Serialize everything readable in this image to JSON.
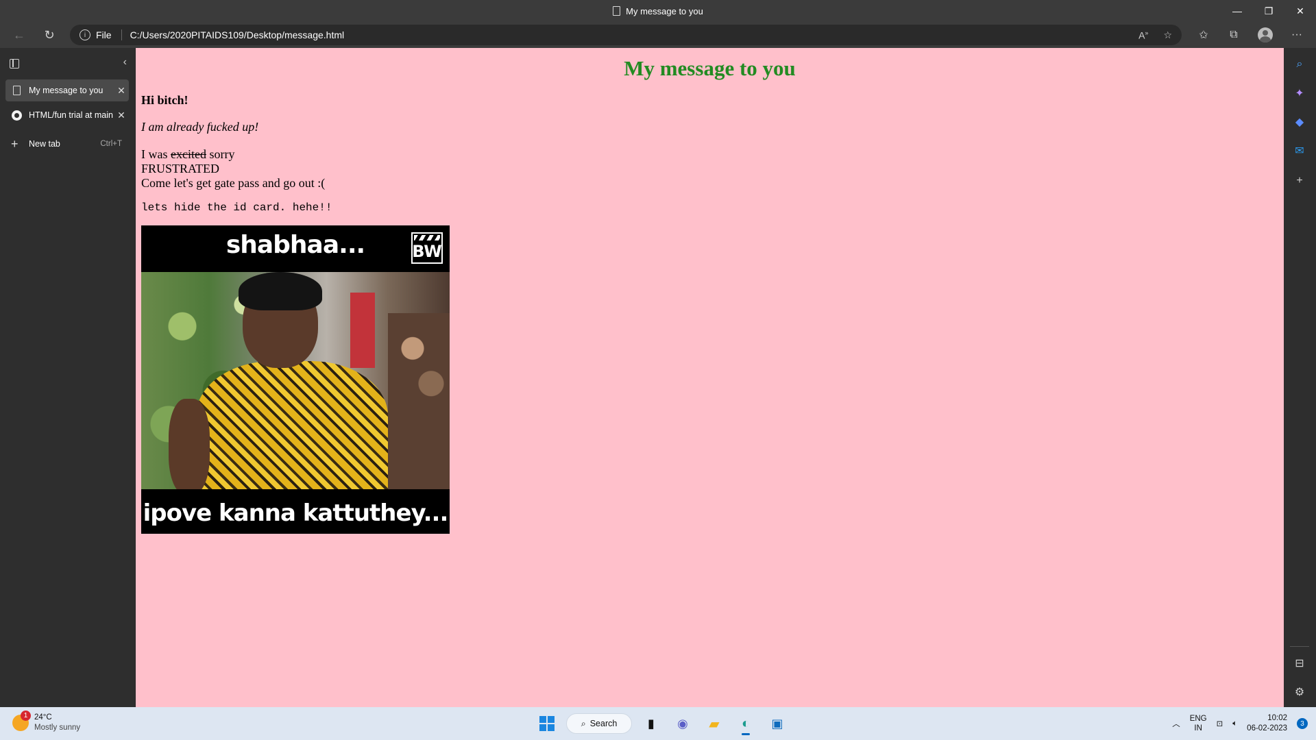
{
  "window": {
    "title": "My message to you",
    "controls": [
      "minimize",
      "restore",
      "close"
    ]
  },
  "address_bar": {
    "scheme_label": "File",
    "url": "C:/Users/2020PITAIDS109/Desktop/message.html"
  },
  "vertical_tabs": {
    "tabs": [
      {
        "label": "My message to you",
        "active": true,
        "icon": "document-icon"
      },
      {
        "label": "HTML/fun trial at main",
        "active": false,
        "icon": "github-icon"
      }
    ],
    "new_tab_label": "New tab",
    "new_tab_shortcut": "Ctrl+T"
  },
  "page": {
    "background": "#ffc0cb",
    "heading": "My message to you",
    "heading_color": "#228b22",
    "greeting": "Hi bitch!",
    "italic_line": "I am already fucked up!",
    "line3_prefix": "I was ",
    "line3_struck": "excited",
    "line3_suffix": " sorry",
    "line4": "FRUSTRATED",
    "line5": "Come let's get gate pass and go out :(",
    "mono_line": "lets hide the id card. hehe!!",
    "meme": {
      "top_text": "shabhaa...",
      "logo_text": "BW",
      "bottom_text": "ipove kanna kattuthey..."
    }
  },
  "taskbar": {
    "weather_temp": "24°C",
    "weather_desc": "Mostly sunny",
    "weather_badge": "1",
    "search_label": "Search",
    "lang_top": "ENG",
    "lang_bottom": "IN",
    "time": "10:02",
    "date": "06-02-2023",
    "notification_count": "3"
  }
}
